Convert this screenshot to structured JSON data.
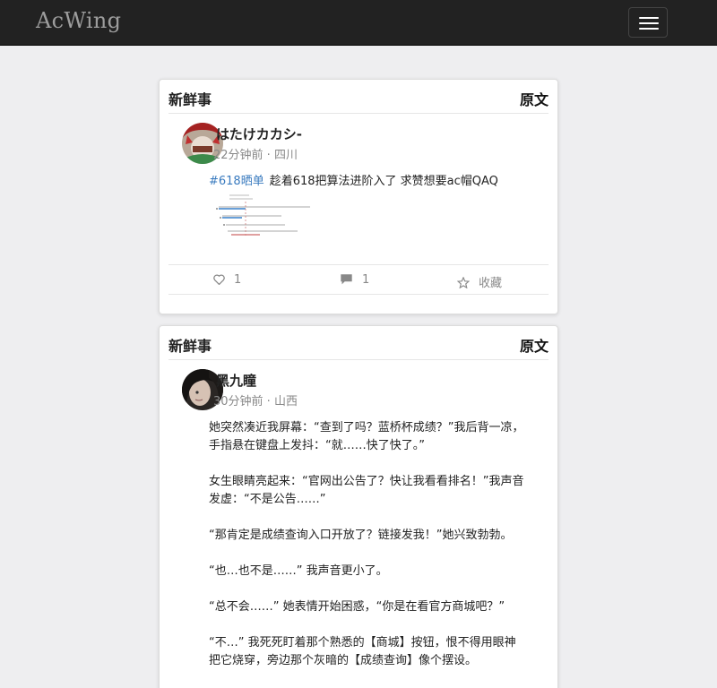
{
  "nav": {
    "brand": "AcWing"
  },
  "posts": [
    {
      "category": "新鲜事",
      "original_label": "原文",
      "author": "はたけカカシ-",
      "time": "22分钟前",
      "location": "四川",
      "tag": "#618晒单",
      "text": "趁着618把算法进阶入了 求赞想要ac帽QAQ",
      "likes": "1",
      "comments": "1",
      "collect_label": "收藏"
    },
    {
      "category": "新鲜事",
      "original_label": "原文",
      "author": "黑九瞳",
      "time": "30分钟前",
      "location": "山西",
      "paragraphs": [
        "她突然凑近我屏幕：“查到了吗？蓝桥杯成绩？”我后背一凉，手指悬在键盘上发抖：“就……快了快了。”",
        "",
        "女生眼睛亮起来：“官网出公告了？快让我看看排名！”我声音发虚：“不是公告……”",
        "",
        "“那肯定是成绩查询入口开放了？链接发我！”她兴致勃勃。",
        "",
        "“也…也不是……” 我声音更小了。",
        "",
        "“总不会……” 她表情开始困惑，“你是在看官方商城吧？”",
        "",
        "“不…” 我死死盯着那个熟悉的【商城】按钮，恨不得用眼神把它烧穿，旁边那个灰暗的【成绩查询】像个摆设。"
      ]
    }
  ]
}
